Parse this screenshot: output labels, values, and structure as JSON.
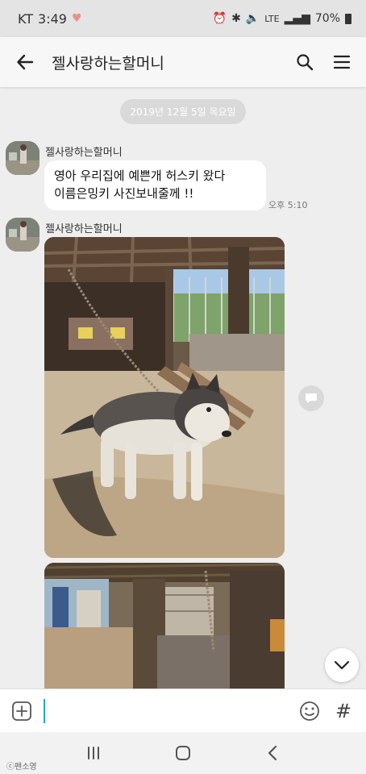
{
  "status_bar": {
    "carrier": "KT",
    "time": "3:49",
    "network": "LTE",
    "battery": "70%"
  },
  "app_bar": {
    "title": "젤사랑하는할머니",
    "back_icon": "arrow-left-icon",
    "search_icon": "search-icon",
    "menu_icon": "hamburger-menu-icon"
  },
  "chat": {
    "date_divider": "2019년 12월 5일 목요일",
    "messages": [
      {
        "sender": "젤사랑하는할머니",
        "lines": [
          "영아 우리집에  예쁜개 허스키 왔다",
          "이름은밍키  사진보내줄께 !!"
        ],
        "time": "오후 5:10"
      },
      {
        "sender": "젤사랑하는할머니",
        "photos": [
          "husky-dog-chained-in-shed-photo",
          "rural-yard-shed-photo"
        ]
      }
    ]
  },
  "composer": {
    "placeholder": "",
    "value": "",
    "hash_label": "#"
  },
  "watermark": "ⓒ펜소영",
  "colors": {
    "status_bg": "#e4e4e4",
    "app_bar_bg": "#f7f7f7",
    "chat_bg": "#eeeeee",
    "bubble_bg": "#ffffff",
    "date_pill_bg": "#d9d9d9",
    "cursor": "#26a9c9"
  }
}
